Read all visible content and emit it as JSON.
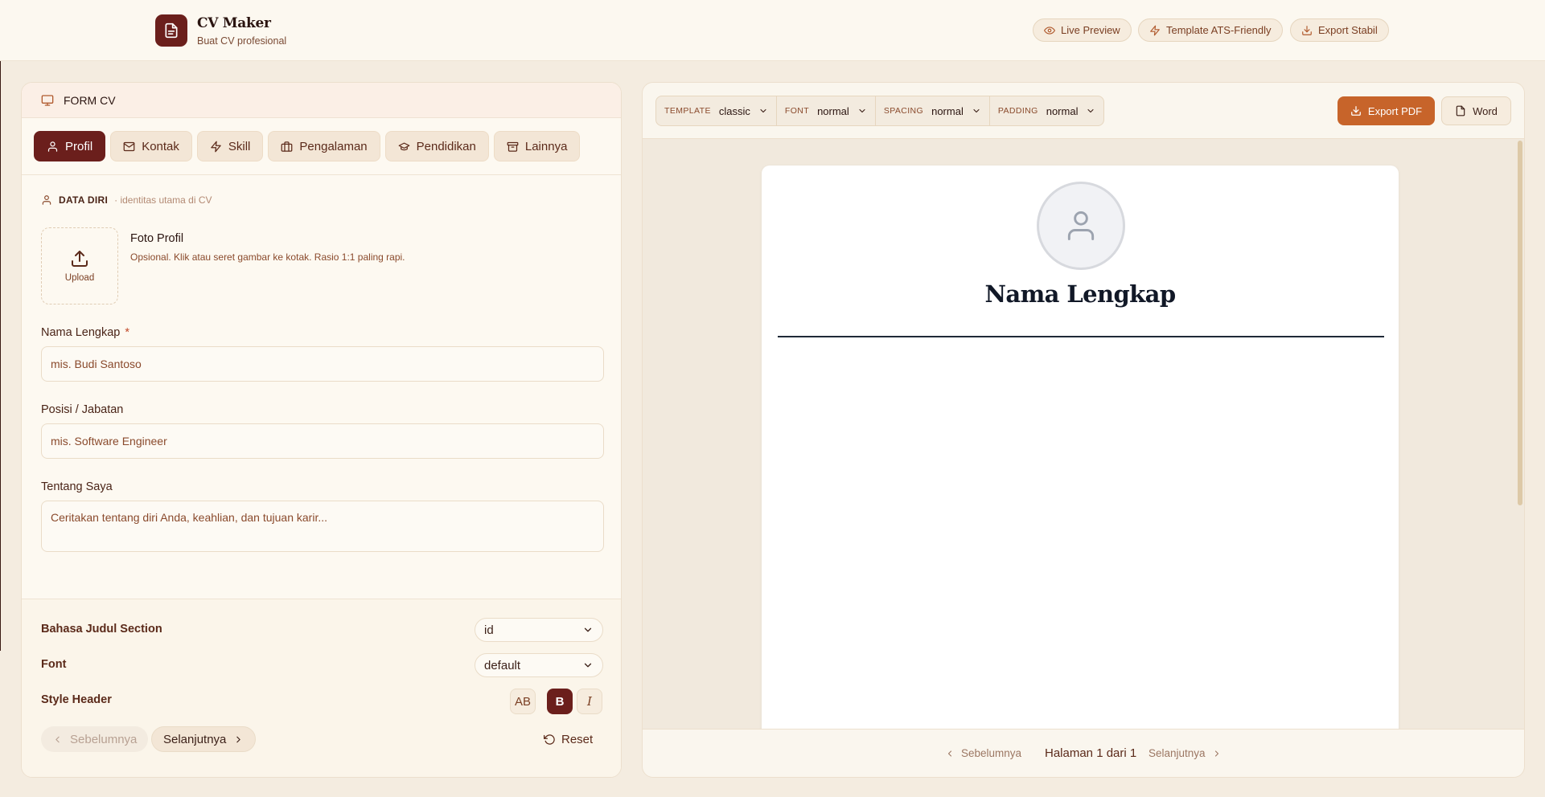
{
  "app": {
    "title": "CV Maker",
    "subtitle": "Buat CV profesional"
  },
  "header_pills": [
    {
      "label": "Live Preview",
      "icon": "eye-icon"
    },
    {
      "label": "Template ATS-Friendly",
      "icon": "bolt-icon"
    },
    {
      "label": "Export Stabil",
      "icon": "download-icon"
    }
  ],
  "form": {
    "panel_title": "FORM CV",
    "tabs": [
      {
        "label": "Profil",
        "icon": "user-icon",
        "active": true
      },
      {
        "label": "Kontak",
        "icon": "mail-icon",
        "active": false
      },
      {
        "label": "Skill",
        "icon": "bolt-icon",
        "active": false
      },
      {
        "label": "Pengalaman",
        "icon": "briefcase-icon",
        "active": false
      },
      {
        "label": "Pendidikan",
        "icon": "graduation-icon",
        "active": false
      },
      {
        "label": "Lainnya",
        "icon": "archive-icon",
        "active": false
      }
    ],
    "section_title": "DATA DIRI",
    "section_hint": "· identitas utama di CV",
    "photo": {
      "upload_label": "Upload",
      "title": "Foto Profil",
      "description": "Opsional. Klik atau seret gambar ke kotak. Rasio 1:1 paling rapi."
    },
    "fields": {
      "name": {
        "label": "Nama Lengkap",
        "required_mark": "*",
        "value": "",
        "placeholder": "mis. Budi Santoso"
      },
      "position": {
        "label": "Posisi / Jabatan",
        "value": "",
        "placeholder": "mis. Software Engineer"
      },
      "about": {
        "label": "Tentang Saya",
        "value": "",
        "placeholder": "Ceritakan tentang diri Anda, keahlian, dan tujuan karir..."
      }
    },
    "settings": {
      "section_language_label": "Bahasa Judul Section",
      "section_language_value": "id",
      "font_label": "Font",
      "font_value": "default",
      "style_header_label": "Style Header",
      "style_options": [
        {
          "label": "AB",
          "active": false
        },
        {
          "label": "B",
          "active": true
        },
        {
          "label": "I",
          "active": false
        }
      ]
    },
    "nav": {
      "prev": "Sebelumnya",
      "next": "Selanjutnya",
      "reset": "Reset"
    }
  },
  "preview": {
    "controls": [
      {
        "key": "TEMPLATE",
        "value": "classic"
      },
      {
        "key": "FONT",
        "value": "normal"
      },
      {
        "key": "SPACING",
        "value": "normal"
      },
      {
        "key": "PADDING",
        "value": "normal"
      }
    ],
    "export_pdf": "Export PDF",
    "export_word": "Word",
    "cv": {
      "name": "Nama Lengkap"
    },
    "pagination": {
      "prev": "Sebelumnya",
      "info": "Halaman 1 dari 1",
      "next": "Selanjutnya"
    }
  },
  "colors": {
    "brand": "#6b1f1c",
    "accent": "#c7642a",
    "background": "#f4ece0"
  }
}
